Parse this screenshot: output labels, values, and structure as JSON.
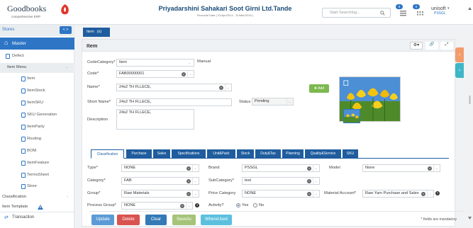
{
  "app": {
    "logo_name": "Goodbooks",
    "logo_sub": "comprehensive ERP",
    "company_name": "Priyadarshini Sahakari Soot Girni Ltd.Tande",
    "financial_date": "Financial Date ( 01/Apr/2014 - 31/Mar/2015 )",
    "search_placeholder": "Start Searching...",
    "notif_count_1": "9",
    "notif_count_2": "0",
    "user_name": "unisoft",
    "user_org": "PSSGL"
  },
  "sidebar": {
    "stores_label": "Stores",
    "stores_toggle": "< >",
    "master_label": "Master",
    "items": [
      {
        "label": "Defect",
        "level": 1
      },
      {
        "label": "Item Menu",
        "level": 0
      },
      {
        "label": "Item",
        "level": 2
      },
      {
        "label": "ItemStock",
        "level": 2
      },
      {
        "label": "ItemSKU",
        "level": 2
      },
      {
        "label": "SKU Generation",
        "level": 2
      },
      {
        "label": "ItemParty",
        "level": 2
      },
      {
        "label": "Routing",
        "level": 2
      },
      {
        "label": "BOM",
        "level": 2
      },
      {
        "label": "ItemFeature",
        "level": 2
      },
      {
        "label": "TermsSheet",
        "level": 2
      },
      {
        "label": "Store",
        "level": 2
      },
      {
        "label": "Classification",
        "level": 0
      },
      {
        "label": "Item Template",
        "level": 0
      }
    ],
    "transaction_label": "Transaction"
  },
  "tab": {
    "label": "Item",
    "close": "(x)"
  },
  "panel": {
    "title": "Item"
  },
  "form": {
    "code_category_label": "CodeCategory*",
    "code_category_value": "Item",
    "manual_label": "Manual",
    "code_label": "Code*",
    "code_value": "FAB00000001",
    "name_label": "Name*",
    "name_value": "24s2 TH FLLECE,",
    "short_name_label": "Short Name*",
    "short_name_value": "24s2 TH FLLECE,",
    "status_label": "Status",
    "status_value": "Pending",
    "description_label": "Description",
    "description_value": "24s2 TH FLLECE,",
    "add_button": "Add"
  },
  "subtabs": [
    "Classification",
    "Purchase",
    "Sales",
    "Specifications",
    "Unit&Pack",
    "Stock",
    "Duty&Tax",
    "Planning",
    "Quality&Service",
    "SKU"
  ],
  "classification": {
    "type_label": "Type*",
    "type_value": "NONE",
    "brand_label": "Brand",
    "brand_value": "PSSGL",
    "model_label": "Model",
    "model_value": "None",
    "category_label": "Category*",
    "category_value": "FAB",
    "subcategory_label": "SubCategory*",
    "subcategory_value": "test",
    "group_label": "Group*",
    "group_value": "Raw Materials",
    "price_category_label": "Price Category",
    "price_category_value": "NONE",
    "material_account_label": "Material Account*",
    "material_account_value": "Raw Yarn Purchase and Sales",
    "process_group_label": "Process Group*",
    "process_group_value": "NONE",
    "activity_label": "Activity?",
    "yes_label": "Yes",
    "no_label": "No",
    "activity_yes_selected": true
  },
  "footer": {
    "update": "Update",
    "delete": "Delete",
    "clear": "Clear",
    "saveas": "SaveAs",
    "whereused": "WhereUsed",
    "mandatory_note": "* fields are mandatory"
  },
  "colors": {
    "accent": "#2e75c5",
    "update": "#5b9bd5",
    "delete": "#d9534f",
    "clear": "#337ab7",
    "saveas": "#a5c47a",
    "whereused": "#5bc0de"
  }
}
